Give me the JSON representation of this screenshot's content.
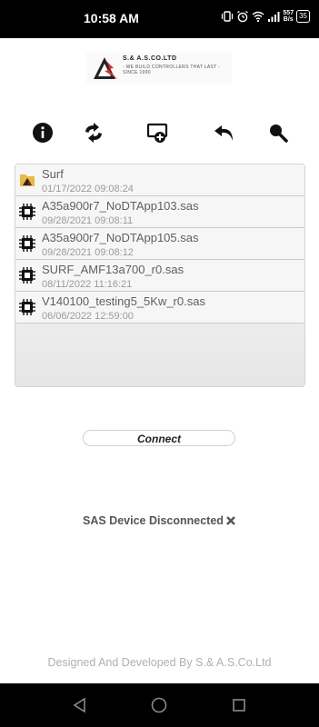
{
  "status_bar": {
    "time": "10:58 AM",
    "net_speed_value": "557",
    "net_speed_unit": "B/s",
    "battery": "35"
  },
  "logo": {
    "title": "S.& A.S.CO.LTD",
    "tagline": "- WE BUILD CONTROLLERS THAT LAST - SINCE 1990"
  },
  "toolbar": {
    "icons": [
      "info-icon",
      "sync-icon",
      "cast-add-icon",
      "undo-icon",
      "search-icon"
    ]
  },
  "files": [
    {
      "name": "Surf",
      "date": "01/17/2022 09:08:24",
      "icon": "folder-icon"
    },
    {
      "name": "A35a900r7_NoDTApp103.sas",
      "date": "09/28/2021 09:08:11",
      "icon": "chip-icon"
    },
    {
      "name": "A35a900r7_NoDTApp105.sas",
      "date": "09/28/2021 09:08:12",
      "icon": "chip-icon"
    },
    {
      "name": "SURF_AMF13a700_r0.sas",
      "date": "08/11/2022 11:16:21",
      "icon": "chip-icon"
    },
    {
      "name": "V140100_testing5_5Kw_r0.sas",
      "date": "06/06/2022 12:59:00",
      "icon": "chip-icon"
    }
  ],
  "connect_label": "Connect",
  "device_status": "SAS Device Disconnected",
  "footer": "Designed And Developed By S.& A.S.Co.Ltd"
}
